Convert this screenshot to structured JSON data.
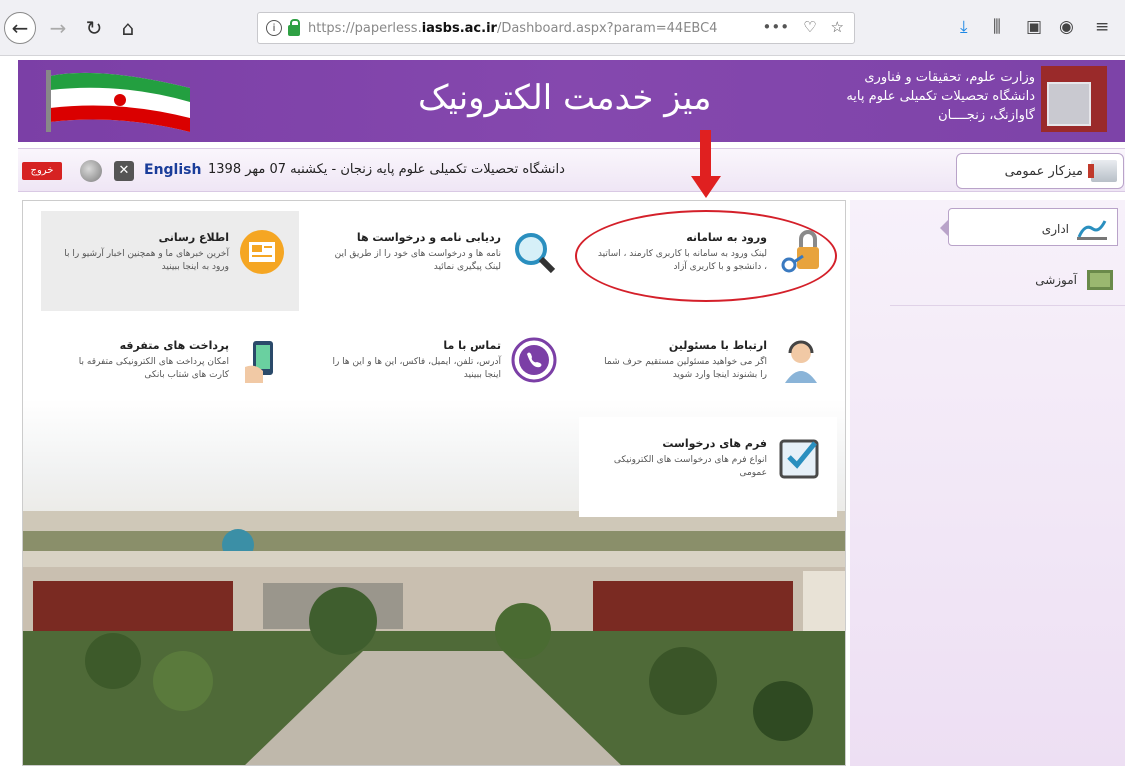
{
  "browser": {
    "url_prefix": "https://paperless.",
    "url_host": "iasbs.ac.ir",
    "url_rest": "/Dashboard.aspx?param=44EBC4"
  },
  "header": {
    "title": "میز خدمت الکترونیک",
    "org_line1": "وزارت علوم، تحقیقات و فناوری",
    "org_line2": "دانشگاه تحصیلات تکمیلی علوم پایه",
    "org_line3": "گاوازنگ، زنجــــان"
  },
  "infobar": {
    "exit_label": "خروج",
    "lang_label": "English",
    "date_text": "دانشگاه تحصیلات تکمیلی علوم پایه زنجان - یکشنبه 07 مهر 1398",
    "dashboard_label": "میزکار عمومی"
  },
  "tiles": [
    {
      "title": "ورود به سامانه",
      "desc": "لینک ورود به سامانه با کاربری کارمند ، اساتید ، دانشجو و با کاربری آزاد",
      "icon": "lock-key-icon"
    },
    {
      "title": "ردیابی نامه و درخواست ها",
      "desc": "نامه ها و درخواست های خود را از طریق این لینک پیگیری نمائید",
      "icon": "magnifier-icon"
    },
    {
      "title": "اطلاع رسانی",
      "desc": "آخرین خبرهای ما و همچنین اخبار آرشیو را با ورود به اینجا ببینید",
      "icon": "newspaper-icon"
    },
    {
      "title": "ارتباط با مسئولین",
      "desc": "اگر می خواهید مسئولین مستقیم حرف شما را بشنوند اینجا وارد شوید",
      "icon": "support-person-icon"
    },
    {
      "title": "تماس با ما",
      "desc": "آدرس، تلفن، ایمیل، فاکس، این ها و این ها را اینجا ببینید",
      "icon": "phone-icon"
    },
    {
      "title": "پرداخت های متفرقه",
      "desc": "امکان پرداخت های الکترونیکی متفرقه با کارت های شتاب بانکی",
      "icon": "mobile-payment-icon"
    },
    {
      "title": "فرم های درخواست",
      "desc": "انواع فرم های درخواست های الکترونیکی عمومی",
      "icon": "form-checkbox-icon"
    }
  ],
  "sidebar": {
    "items": [
      {
        "label": "اداری",
        "icon": "admin-icon"
      },
      {
        "label": "آموزشی",
        "icon": "education-icon"
      }
    ]
  },
  "colors": {
    "banner": "#7b3fa6",
    "annotation": "#e02020"
  }
}
